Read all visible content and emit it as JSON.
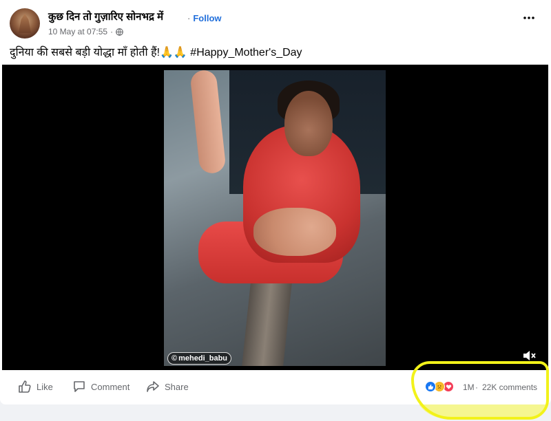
{
  "post": {
    "page_name": "कुछ दिन तो गुज़ारिए सोनभद्र में",
    "follow_label": "Follow",
    "timestamp": "10 May at 07:55",
    "caption": "दुनिया की सबसे बड़ी योद्धा माँ होती हैं!🙏🙏 #Happy_Mother's_Day",
    "privacy_icon": "globe-icon",
    "more_icon": "more-options-icon"
  },
  "video": {
    "watermark": "mehedi_babu",
    "mute_icon": "volume-muted-icon"
  },
  "actions": {
    "like_label": "Like",
    "comment_label": "Comment",
    "share_label": "Share"
  },
  "stats": {
    "reaction_icons": [
      "like-reaction-icon",
      "sad-reaction-icon",
      "love-reaction-icon"
    ],
    "reaction_count": "1M",
    "separator": "·",
    "comments_count": "22K comments"
  },
  "colors": {
    "link_blue": "#216fdb",
    "secondary_text": "#65676b",
    "highlight": "#f2f21a"
  }
}
